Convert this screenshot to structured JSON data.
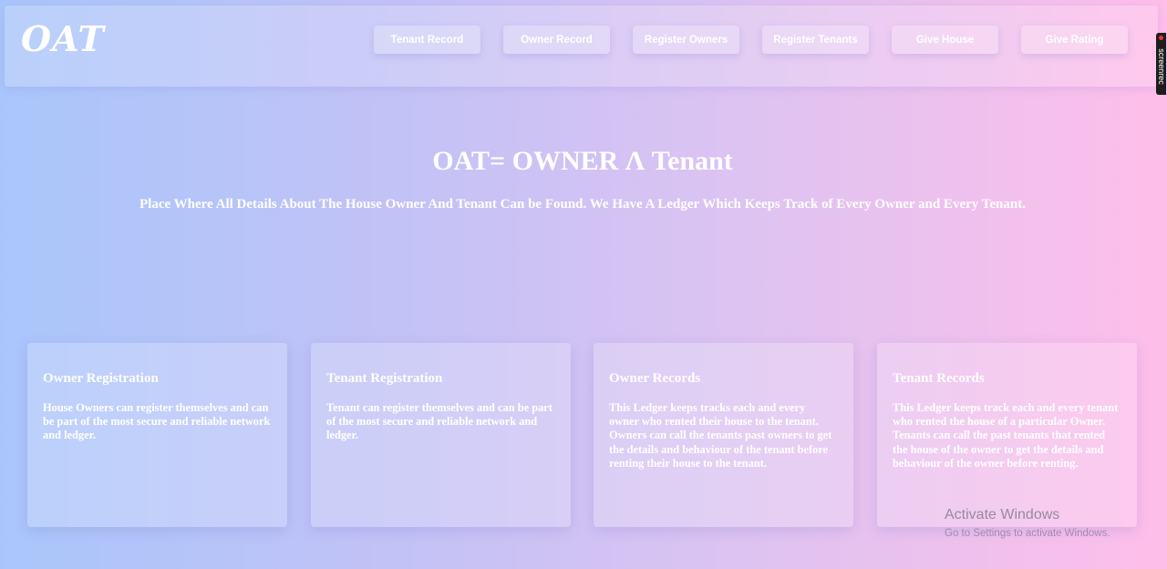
{
  "navbar": {
    "logo": "OAT",
    "items": [
      {
        "label": "Tenant Record"
      },
      {
        "label": "Owner Record"
      },
      {
        "label": "Register Owners"
      },
      {
        "label": "Register Tenants"
      },
      {
        "label": "Give House"
      },
      {
        "label": "Give Rating"
      }
    ]
  },
  "hero": {
    "title": "OAT= OWNER Λ Tenant",
    "subtitle": "Place Where All Details About The House Owner And Tenant Can be Found. We Have A Ledger Which Keeps Track of Every Owner and Every Tenant."
  },
  "cards": [
    {
      "title": "Owner Registration",
      "text": "House Owners can register themselves and can be part of the most secure and reliable network and ledger."
    },
    {
      "title": "Tenant Registration",
      "text": "Tenant can register themselves and can be part of the most secure and reliable network and ledger."
    },
    {
      "title": "Owner Records",
      "text": "This Ledger keeps tracks each and every owner who rented their house to the tenant. Owners can call the tenants past owners to get the details and behaviour of the tenant before renting their house to the tenant."
    },
    {
      "title": "Tenant Records",
      "text": "This Ledger keeps track each and every tenant who rented the house of a particular Owner. Tenants can call the past tenants that rented the house of the owner to get the details and behaviour of the owner before renting."
    }
  ],
  "overlay": {
    "recorder_label": "screenrec",
    "activate_title": "Activate Windows",
    "activate_sub": "Go to Settings to activate Windows."
  },
  "colors": {
    "gradient_left": "#a9c6fb",
    "gradient_right": "#ffbeea",
    "text": "#ffffff"
  }
}
